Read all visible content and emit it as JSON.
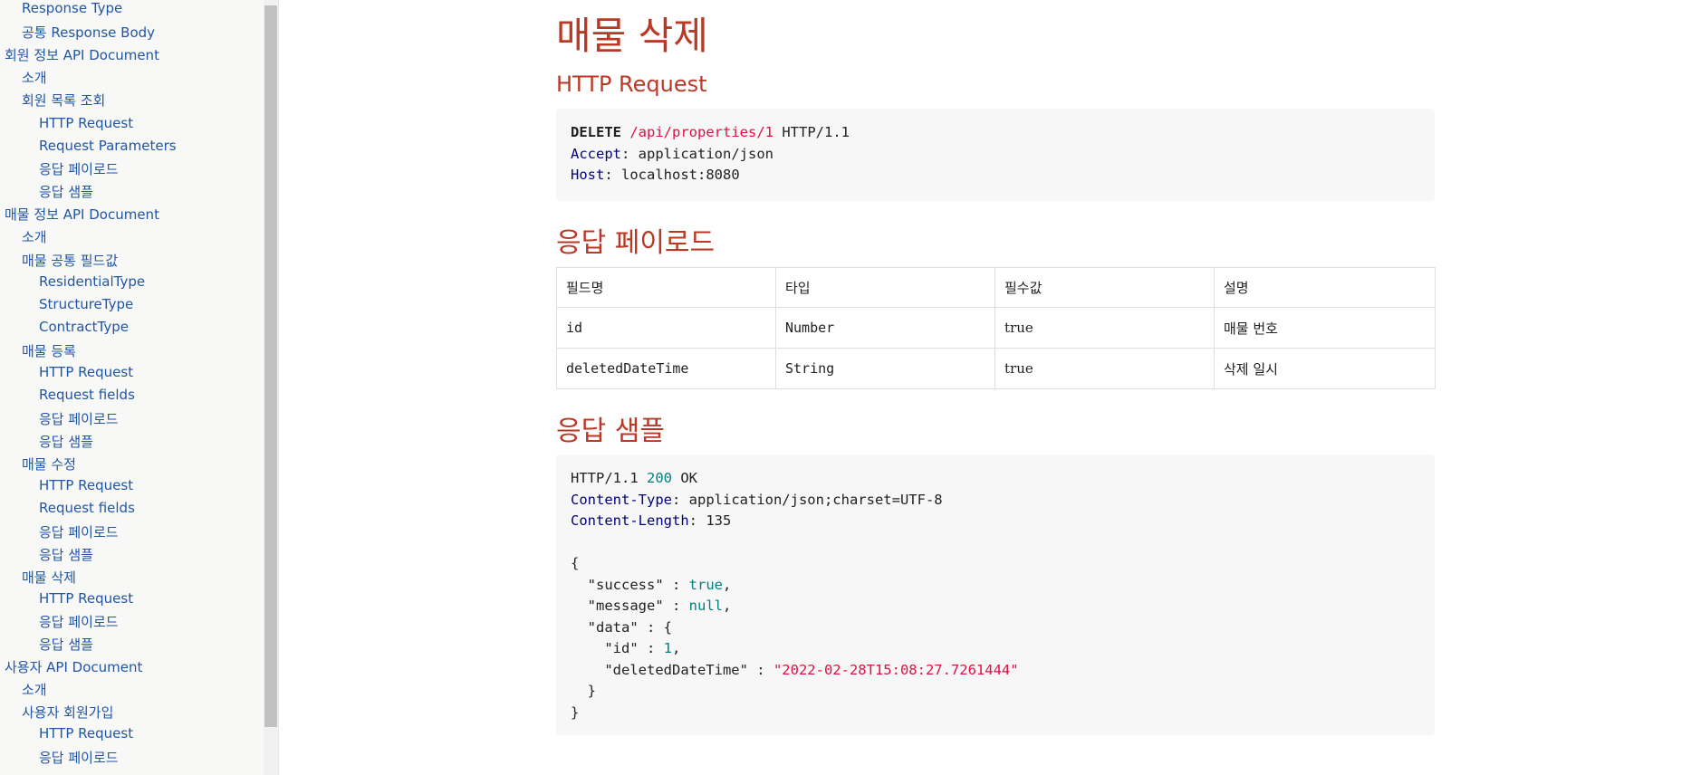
{
  "toc": [
    {
      "label": "Response Type",
      "level": 2
    },
    {
      "label": "공통 Response Body",
      "level": 2
    },
    {
      "label": "회원 정보 API Document",
      "level": 1
    },
    {
      "label": "소개",
      "level": 2
    },
    {
      "label": "회원 목록 조회",
      "level": 2
    },
    {
      "label": "HTTP Request",
      "level": 3
    },
    {
      "label": "Request Parameters",
      "level": 3
    },
    {
      "label": "응답 페이로드",
      "level": 3
    },
    {
      "label": "응답 샘플",
      "level": 3
    },
    {
      "label": "매물 정보 API Document",
      "level": 1
    },
    {
      "label": "소개",
      "level": 2
    },
    {
      "label": "매물 공통 필드값",
      "level": 2
    },
    {
      "label": "ResidentialType",
      "level": 3
    },
    {
      "label": "StructureType",
      "level": 3
    },
    {
      "label": "ContractType",
      "level": 3
    },
    {
      "label": "매물 등록",
      "level": 2
    },
    {
      "label": "HTTP Request",
      "level": 3
    },
    {
      "label": "Request fields",
      "level": 3
    },
    {
      "label": "응답 페이로드",
      "level": 3
    },
    {
      "label": "응답 샘플",
      "level": 3
    },
    {
      "label": "매물 수정",
      "level": 2
    },
    {
      "label": "HTTP Request",
      "level": 3
    },
    {
      "label": "Request fields",
      "level": 3
    },
    {
      "label": "응답 페이로드",
      "level": 3
    },
    {
      "label": "응답 샘플",
      "level": 3
    },
    {
      "label": "매물 삭제",
      "level": 2
    },
    {
      "label": "HTTP Request",
      "level": 3
    },
    {
      "label": "응답 페이로드",
      "level": 3
    },
    {
      "label": "응답 샘플",
      "level": 3
    },
    {
      "label": "사용자 API Document",
      "level": 1
    },
    {
      "label": "소개",
      "level": 2
    },
    {
      "label": "사용자 회원가입",
      "level": 2
    },
    {
      "label": "HTTP Request",
      "level": 3
    },
    {
      "label": "응답 페이로드",
      "level": 3
    }
  ],
  "main": {
    "title": "매물 삭제",
    "http_request": {
      "heading": "HTTP Request",
      "method": "DELETE",
      "path": "/api/properties/1",
      "protocol": "HTTP/1.1",
      "headers": [
        {
          "name": "Accept",
          "value": "application/json"
        },
        {
          "name": "Host",
          "value": "localhost:8080"
        }
      ]
    },
    "payload": {
      "heading": "응답 페이로드",
      "columns": [
        "필드명",
        "타입",
        "필수값",
        "설명"
      ],
      "rows": [
        {
          "field": "id",
          "type": "Number",
          "required": "true",
          "description": "매물 번호"
        },
        {
          "field": "deletedDateTime",
          "type": "String",
          "required": "true",
          "description": "삭제 일시"
        }
      ]
    },
    "sample": {
      "heading": "응답 샘플",
      "protocol": "HTTP/1.1",
      "status_code": "200",
      "status_text": "OK",
      "headers": [
        {
          "name": "Content-Type",
          "value": "application/json;charset=UTF-8"
        },
        {
          "name": "Content-Length",
          "value": "135"
        }
      ],
      "body": {
        "open": "{",
        "success_key": "\"success\"",
        "success_val": "true",
        "message_key": "\"message\"",
        "message_val": "null",
        "data_key": "\"data\"",
        "data_open": "{",
        "id_key": "\"id\"",
        "id_val": "1",
        "dt_key": "\"deletedDateTime\"",
        "dt_val": "\"2022-02-28T15:08:27.7261444\"",
        "data_close": "}",
        "close": "}"
      }
    }
  }
}
